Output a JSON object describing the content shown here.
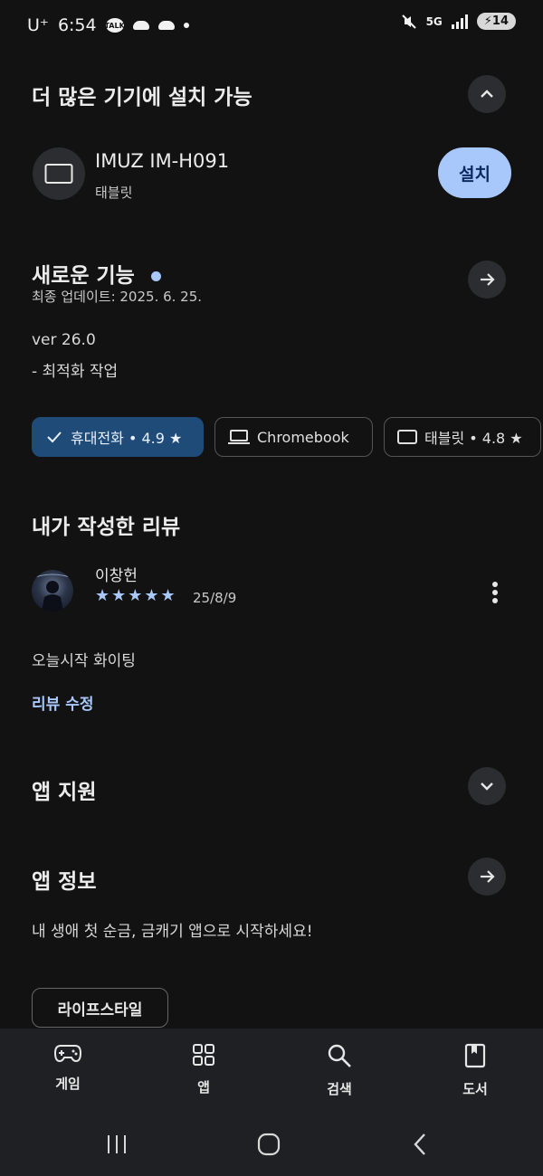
{
  "status_bar": {
    "carrier": "U⁺",
    "time": "6:54",
    "talk_label": "TALK",
    "network": "5G",
    "battery": "14"
  },
  "devices_section": {
    "title": "더 많은 기기에 설치 가능",
    "device_name": "IMUZ IM-H091",
    "device_type": "태블릿",
    "install_label": "설치"
  },
  "whats_new": {
    "title": "새로운 기능",
    "updated": "최종 업데이트: 2025. 6. 25.",
    "version": "ver 26.0",
    "note": "- 최적화 작업"
  },
  "device_chips": [
    {
      "label": "휴대전화 • 4.9 ★",
      "selected": true
    },
    {
      "label": "Chromebook",
      "selected": false
    },
    {
      "label": "태블릿 • 4.8 ★",
      "selected": false
    }
  ],
  "my_review": {
    "title": "내가 작성한 리뷰",
    "author": "이창헌",
    "stars": "★★★★★",
    "rating": 5,
    "date": "25/8/9",
    "text": "오늘시작 화이팅",
    "edit_label": "리뷰 수정"
  },
  "app_support": {
    "title": "앱 지원"
  },
  "app_info": {
    "title": "앱 정보",
    "description": "내 생애 첫 순금, 금캐기 앱으로 시작하세요!",
    "tag": "라이프스타일"
  },
  "bottom_nav": [
    {
      "label": "게임",
      "icon": "gamepad-icon"
    },
    {
      "label": "앱",
      "icon": "apps-grid-icon"
    },
    {
      "label": "검색",
      "icon": "search-icon"
    },
    {
      "label": "도서",
      "icon": "book-icon"
    }
  ],
  "colors": {
    "background": "#121212",
    "accent": "#a8c7fa",
    "selected_chip": "#1f4b78",
    "nav_background": "#1f2024"
  }
}
